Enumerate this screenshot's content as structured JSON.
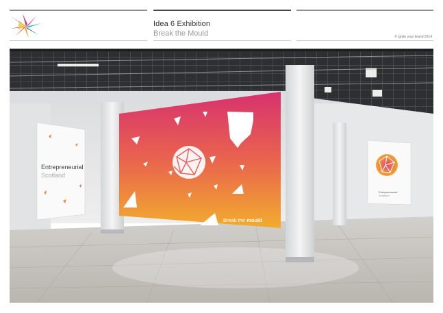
{
  "header": {
    "title": "Idea 6 Exhibition",
    "subtitle": "Break the Mould",
    "copyright": "© ignite your brand 2014"
  },
  "scene": {
    "left_poster": {
      "line1": "Entrepreneurial",
      "line2": "Scotland"
    },
    "center_poster": {
      "tagline_pre": "Break the ",
      "tagline_post": "mould"
    },
    "right_poster": {
      "line1": "Entrepreneurial",
      "line2": "Scotland"
    }
  },
  "colors": {
    "gradient_top": "#d6336c",
    "gradient_bottom": "#f2a92e",
    "wall": "#e8e9ea",
    "floor": "#cfcdc9",
    "ceiling": "#2b2c2e"
  }
}
